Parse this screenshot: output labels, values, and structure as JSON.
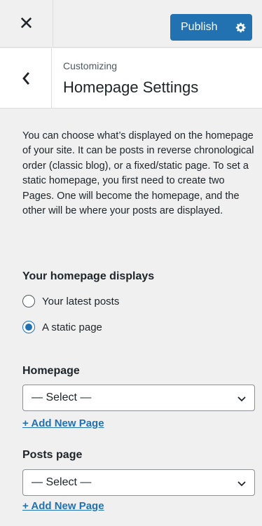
{
  "header": {
    "close_icon": "close-icon",
    "publish_label": "Publish",
    "gear_icon": "gear-icon"
  },
  "section": {
    "back_icon": "chevron-left-icon",
    "subtitle": "Customizing",
    "title": "Homepage Settings"
  },
  "description": "You can choose what’s displayed on the homepage of your site. It can be posts in reverse chronological order (classic blog), or a fixed/static page. To set a static homepage, you first need to create two Pages. One will become the homepage, and the other will be where your posts are displayed.",
  "displays": {
    "label": "Your homepage displays",
    "options": [
      {
        "label": "Your latest posts",
        "checked": false
      },
      {
        "label": "A static page",
        "checked": true
      }
    ]
  },
  "homepage": {
    "label": "Homepage",
    "selected": "— Select —",
    "add_link": "+ Add New Page"
  },
  "posts_page": {
    "label": "Posts page",
    "selected": "— Select —",
    "add_link": "+ Add New Page"
  },
  "colors": {
    "accent": "#2271b1",
    "background": "#f0f0f1",
    "text": "#1d2327"
  }
}
